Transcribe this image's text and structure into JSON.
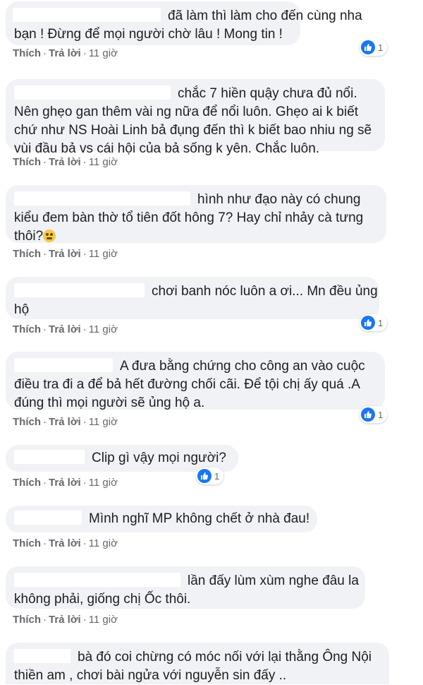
{
  "actions": {
    "like": "Thích",
    "reply": "Trả lời",
    "time": "11 giờ",
    "sep": "·"
  },
  "comments": [
    {
      "lines": [
        "đã làm thì làm cho đến cùng nha",
        "bạn ! Đừng để mọi người chờ lâu ! Mong tin !"
      ],
      "likes": "1"
    },
    {
      "lines": [
        "chắc 7 hiền quậy chưa đủ nổi.",
        "Nên ghẹo gan thêm vài ng nữa để nổi luôn. Ghẹo ai k biết",
        "chứ như NS Hoài Linh bả đụng đến thì k biết bao nhiu ng sẽ",
        "vùi đầu bả vs cái hội của bả sống k yên. Chắc luôn."
      ],
      "likes": ""
    },
    {
      "lines": [
        "hình như đạo này có chung",
        "kiểu đem bàn thờ tổ tiên đốt hông 7? Hay chỉ nhảy cà tưng",
        "thôi?"
      ],
      "emoji": "face-with-spiral-eyes",
      "likes": ""
    },
    {
      "lines": [
        "chơi banh nóc luôn a ơi... Mn đều ủng",
        "hộ"
      ],
      "likes": "1"
    },
    {
      "lines": [
        "A đưa bằng chứng cho công an vào cuộc",
        "điều tra đi a để bả hết đường chối cãi. Để tội chị ấy quá .A",
        "đúng thì mọi người sẽ ủng hộ a."
      ],
      "likes": "1"
    },
    {
      "lines": [
        "Clip gì vậy mọi người?"
      ],
      "likes": "1"
    },
    {
      "lines": [
        "Mình nghĩ MP không chết ở nhà đau!"
      ],
      "likes": ""
    },
    {
      "lines": [
        "lần đấy lùm xùm nghe đâu la",
        "không phải, giống chị Ốc thôi."
      ],
      "likes": ""
    },
    {
      "lines": [
        "bà đó coi chừng có móc nối với lại thằng Ông Nội",
        "thiền am , chơi bài ngửa với nguyễn sin đấy .."
      ],
      "likes": ""
    }
  ],
  "colors": {
    "bubble": "#f0f2f5",
    "like_blue": "#1877f2",
    "meta": "#65676b"
  }
}
